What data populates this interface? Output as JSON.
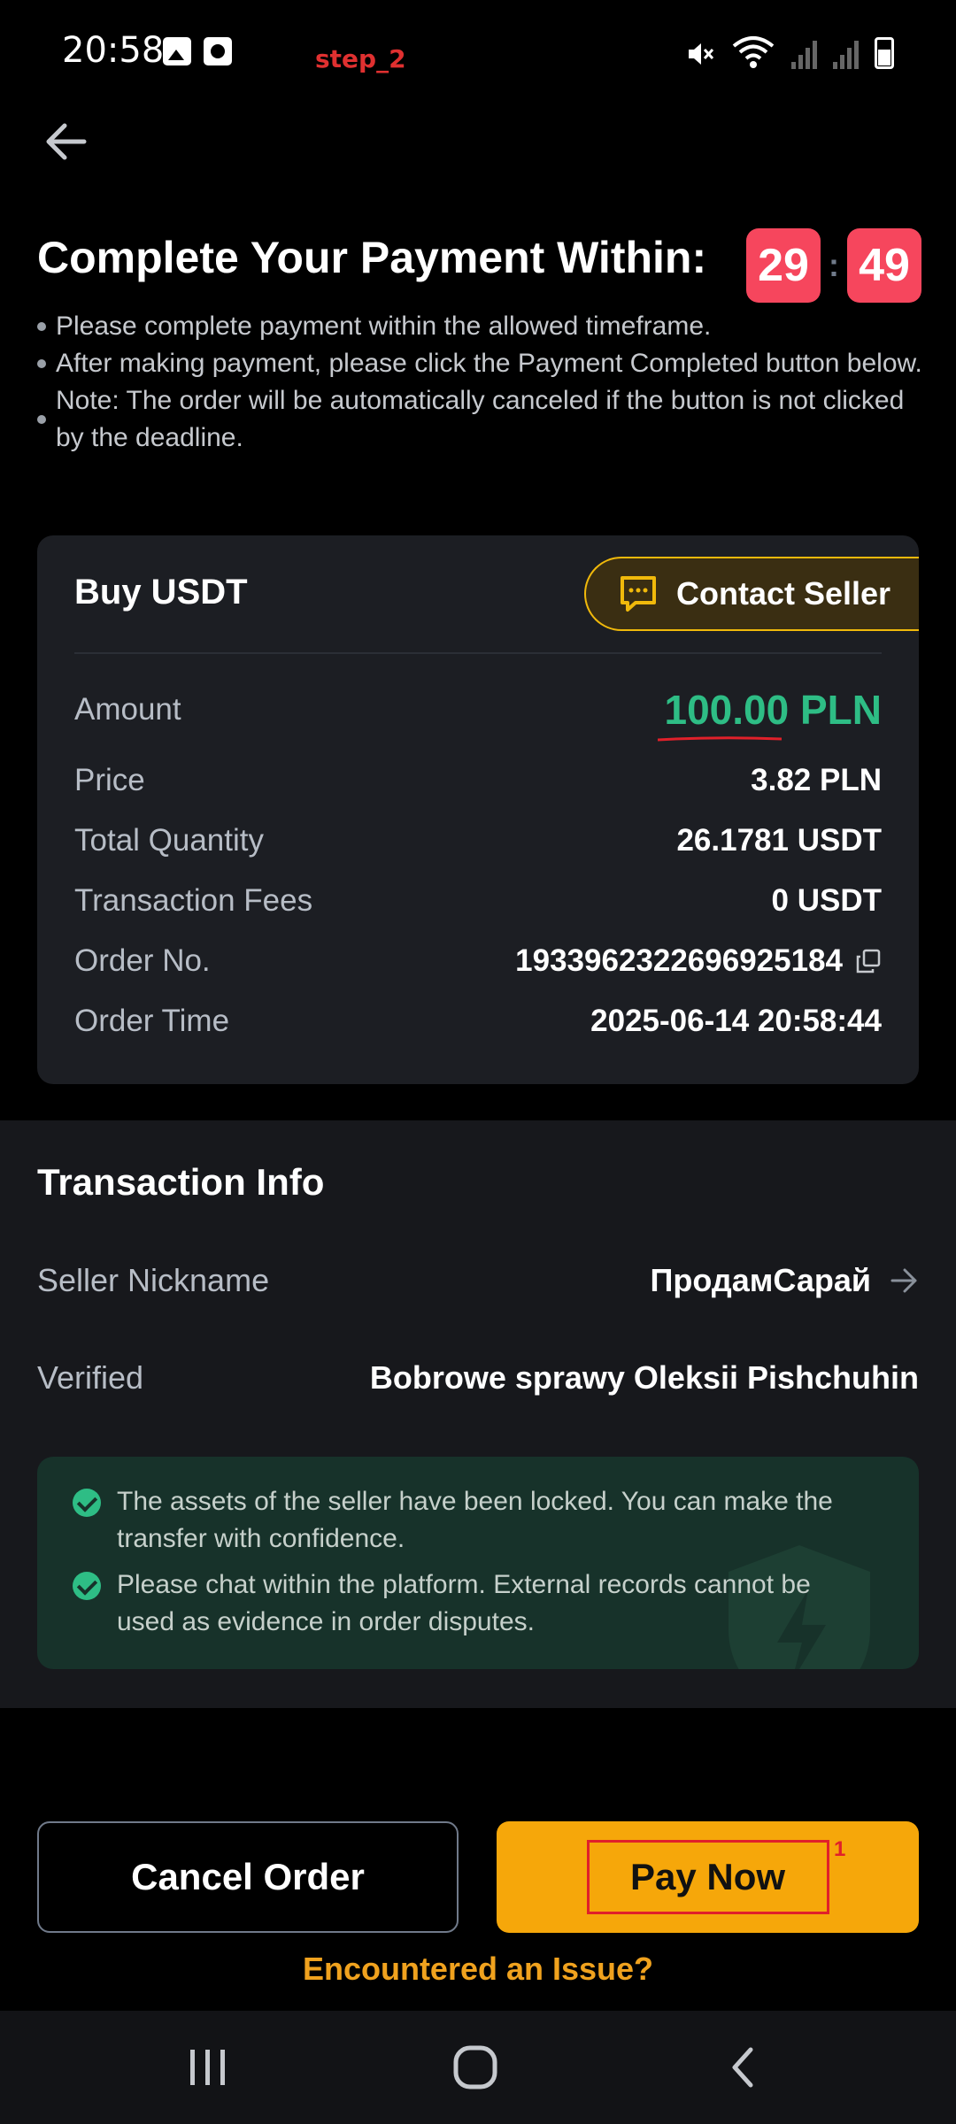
{
  "status_bar": {
    "time": "20:58",
    "step_label": "step_2",
    "icons": [
      "gallery-icon",
      "clock-app-icon",
      "mute-icon",
      "wifi-icon",
      "signal-icon",
      "battery-icon"
    ]
  },
  "header": {
    "back_icon": "arrow-left-icon",
    "title": "Complete Your Payment Within:",
    "timer": {
      "minutes": "29",
      "separator": ":",
      "seconds": "49"
    }
  },
  "notes": [
    "Please complete payment within the allowed timeframe.",
    "After making payment, please click the Payment Completed button below.",
    "Note: The order will be automatically canceled if the button is not clicked by the deadline."
  ],
  "order_card": {
    "title": "Buy USDT",
    "contact_seller": "Contact Seller",
    "rows": [
      {
        "label": "Amount",
        "value": "100.00 PLN"
      },
      {
        "label": "Price",
        "value": "3.82 PLN"
      },
      {
        "label": "Total Quantity",
        "value": "26.1781 USDT"
      },
      {
        "label": "Transaction Fees",
        "value": "0 USDT"
      },
      {
        "label": "Order No.",
        "value": "1933962322696925184"
      },
      {
        "label": "Order Time",
        "value": "2025-06-14 20:58:44"
      }
    ]
  },
  "transaction_info": {
    "title": "Transaction Info",
    "seller_label": "Seller Nickname",
    "seller_value": "ПродамСарай",
    "verified_label": "Verified",
    "verified_value": "Bobrowe sprawy Oleksii Pishchuhin",
    "assurances": [
      "The assets of the seller have been locked. You can make the transfer with confidence.",
      "Please chat within the platform. External records cannot be used as evidence in order disputes."
    ]
  },
  "actions": {
    "cancel": "Cancel Order",
    "pay": "Pay Now",
    "marker": "1",
    "issue_link": "Encountered an Issue?"
  },
  "colors": {
    "accent": "#F6A70A",
    "danger": "#F6465D",
    "success": "#2EBD85",
    "card": "#1C1E23"
  }
}
